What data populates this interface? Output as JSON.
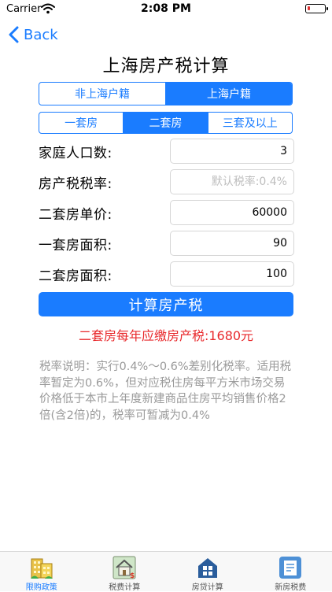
{
  "status_bar": {
    "carrier": "Carrier",
    "time": "2:08 PM"
  },
  "nav": {
    "back_label": "Back"
  },
  "page": {
    "title": "上海房产税计算"
  },
  "household_tabs": [
    {
      "label": "非上海户籍",
      "active": false
    },
    {
      "label": "上海户籍",
      "active": true
    }
  ],
  "property_tabs": [
    {
      "label": "一套房",
      "active": false
    },
    {
      "label": "二套房",
      "active": true
    },
    {
      "label": "三套及以上",
      "active": false
    }
  ],
  "form": {
    "family_size": {
      "label": "家庭人口数:",
      "value": "3"
    },
    "tax_rate": {
      "label": "房产税税率:",
      "value": "",
      "placeholder": "默认税率:0.4%"
    },
    "second_unit_price": {
      "label": "二套房单价:",
      "value": "60000"
    },
    "first_area": {
      "label": "一套房面积:",
      "value": "90"
    },
    "second_area": {
      "label": "二套房面积:",
      "value": "100"
    }
  },
  "calculate_button": {
    "label": "计算房产税"
  },
  "result": {
    "text": "二套房每年应缴房产税:1680元"
  },
  "explanation": {
    "text": "税率说明：实行0.4%～0.6%差别化税率。适用税率暂定为0.6%，但对应税住房每平方米市场交易价格低于本市上年度新建商品住房平均销售价格2倍(含2倍)的，税率可暂减为0.4%"
  },
  "tabbar": {
    "items": [
      {
        "label": "限购政策",
        "icon": "building-icon",
        "active": true
      },
      {
        "label": "税费计算",
        "icon": "house-icon",
        "active": false
      },
      {
        "label": "房贷计算",
        "icon": "calculator-icon",
        "active": false
      },
      {
        "label": "新房税费",
        "icon": "tax-form-icon",
        "active": false
      }
    ]
  },
  "colors": {
    "accent": "#1a7cff",
    "result": "#e8292c",
    "explanation": "#9a9a9a",
    "placeholder": "#bdbdbd"
  }
}
